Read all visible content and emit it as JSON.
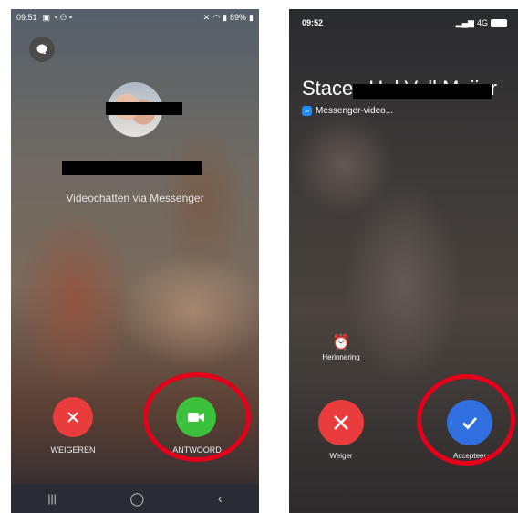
{
  "android": {
    "status_time": "09:51",
    "status_battery": "89%",
    "subtitle": "Videochatten via Messenger",
    "decline_label": "WEIGEREN",
    "answer_label": "ANTWOORD",
    "colors": {
      "decline": "#ea3c3c",
      "answer": "#3cc13c"
    }
  },
  "ios": {
    "status_time": "09:52",
    "network": "4G",
    "caller_name": "Stacey Hal Vell Meijer",
    "app_line": "Messenger-video...",
    "reminder_label": "Herinnering",
    "decline_label": "Weiger",
    "accept_label": "Accepteer",
    "colors": {
      "decline": "#ea3c3c",
      "accept": "#2f6fdf"
    }
  },
  "highlight_color": "#e4001b"
}
